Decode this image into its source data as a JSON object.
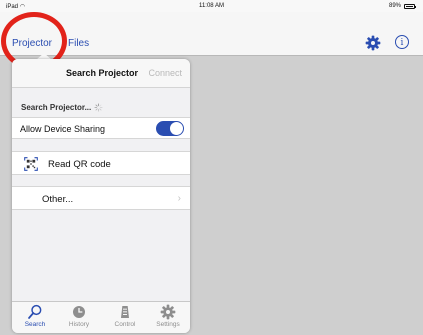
{
  "status_bar": {
    "device": "iPad",
    "time": "11:08 AM",
    "battery": "89%"
  },
  "nav": {
    "tabs": [
      {
        "label": "Projector"
      },
      {
        "label": "Files"
      }
    ]
  },
  "popover": {
    "title": "Search Projector",
    "connect_label": "Connect",
    "searching_label": "Search Projector...",
    "sharing_label": "Allow Device Sharing",
    "sharing_enabled": true,
    "qr_label": "Read QR code",
    "other_label": "Other...",
    "chevron": "›"
  },
  "tabbar": {
    "tabs": [
      {
        "label": "Search",
        "icon": "search-icon",
        "active": true
      },
      {
        "label": "History",
        "icon": "clock-icon",
        "active": false
      },
      {
        "label": "Control",
        "icon": "projector-icon",
        "active": false
      },
      {
        "label": "Settings",
        "icon": "gear-icon",
        "active": false
      }
    ]
  },
  "colors": {
    "accent": "#2a4db1",
    "highlight": "#e2231a",
    "muted": "#8e8e8e"
  }
}
